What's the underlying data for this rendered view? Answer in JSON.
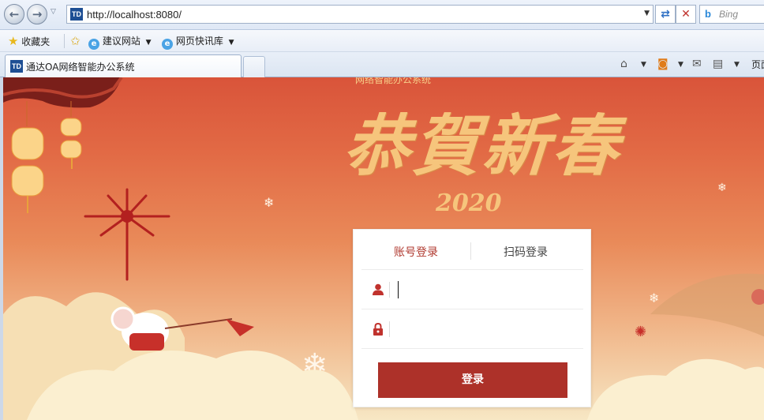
{
  "browser": {
    "url": "http://localhost:8080/",
    "search_placeholder": "Bing",
    "favorites": {
      "favorites_label": "收藏夹",
      "suggested_sites": "建议网站",
      "web_slices": "网页快讯库"
    },
    "tab": {
      "title": "通达OA网络智能办公系统",
      "favicon_text": "TD"
    },
    "page_menu_label": "页面"
  },
  "page": {
    "cover_title": "网络智能办公系统",
    "greeting": "恭賀新春",
    "year": "2020",
    "login": {
      "tab_account": "账号登录",
      "tab_qr": "扫码登录",
      "username_value": "",
      "password_value": "",
      "submit_label": "登录"
    }
  },
  "colors": {
    "accent": "#ad3129",
    "active_tab_text": "#b03a30",
    "background_top": "#d9543a",
    "background_bottom": "#f7e7c4",
    "gold": "#f6c57c"
  }
}
